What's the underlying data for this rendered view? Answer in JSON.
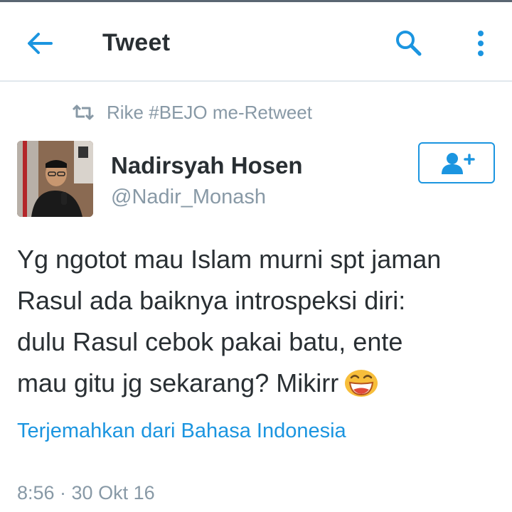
{
  "header": {
    "title": "Tweet"
  },
  "retweet": {
    "label": "Rike #BEJO me-Retweet"
  },
  "author": {
    "name": "Nadirsyah Hosen",
    "handle": "@Nadir_Monash"
  },
  "tweet": {
    "lines": [
      "Yg ngotot mau Islam murni spt jaman",
      "Rasul ada baiknya introspeksi diri:",
      "dulu Rasul cebok pakai batu, ente",
      "mau gitu jg sekarang? Mikirr"
    ],
    "emoji": "grinning-face-emoji"
  },
  "translate_link": "Terjemahkan dari Bahasa Indonesia",
  "timestamp": "8:56 · 30 Okt 16",
  "icons": {
    "back": "back-arrow-icon",
    "search": "search-icon",
    "more": "more-vertical-icon",
    "retweet": "retweet-icon",
    "follow": "add-user-icon"
  },
  "colors": {
    "accent": "#1b95e0",
    "text": "#292f33",
    "secondary": "#8899a6"
  }
}
